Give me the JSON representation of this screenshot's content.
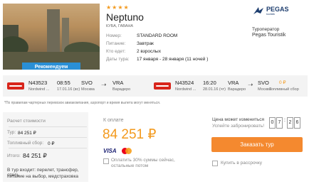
{
  "hotel": {
    "stars": "★★★★",
    "name": "Neptuno",
    "location": "КУБА, ГАВАНА",
    "badge": "Рекомендуем"
  },
  "details": [
    {
      "label": "Номер:",
      "value": "STANDARD ROOM"
    },
    {
      "label": "Питание:",
      "value": "Завтрак"
    },
    {
      "label": "Кто едет:",
      "value": "2 взрослых"
    },
    {
      "label": "Даты тура:",
      "value": "17 января - 28 января (11 ночей )"
    }
  ],
  "operator": {
    "logo": "PEGAS",
    "logo_sub": "touristik",
    "label": "Туроператор",
    "value": "Pegas Touristik"
  },
  "flights": {
    "outbound": {
      "code": "N43523",
      "airline": "Nordwind ...",
      "time": "08:55",
      "date": "17.01.16 (вс)",
      "from_code": "SVO",
      "from_city": "Москва",
      "to_code": "VRA",
      "to_city": "Варадеро"
    },
    "inbound": {
      "code": "N43524",
      "airline": "Nordwind ...",
      "time": "16:20",
      "date": "28.01.16 (чт)",
      "from_code": "VRA",
      "from_city": "Варадеро",
      "to_code": "SVO",
      "to_city": "Москва"
    },
    "fuel_value": "0 ₽",
    "fuel_label": "Топливный сбор"
  },
  "note": "*По правилам чартерных перевозок авиакомпания, аэропорт и время вылета могут меняться.",
  "calc": {
    "title": "Расчет стоимости",
    "tour_label": "Тур:",
    "tour_value": "84 251 ₽",
    "fuel_label": "Топливный сбор:",
    "fuel_value": "0 ₽",
    "total_label": "Итого:",
    "total_value": "84 251 ₽",
    "includes_line1": "В тур входит: перелет, трансфер, отель,",
    "includes_line2": "питание на выбор, медстраховка"
  },
  "payment": {
    "label": "К оплате",
    "price": "84 251 ₽",
    "visa": "VISA",
    "partial_line1": "Оплатить 30% суммы сейчас,",
    "partial_line2": "остальные потом"
  },
  "timer": {
    "line1": "Цена может измениться",
    "line2": "Успейте забронировать!",
    "d1": "0",
    "d2": "7",
    "d3": "2",
    "d4": "6"
  },
  "actions": {
    "order": "Заказать тур",
    "credit": "Купить в рассрочку"
  },
  "colors": {
    "accent": "#f39a1e",
    "button": "#f4892f",
    "badge": "#2a8fd6",
    "airline": "#d8251b"
  }
}
